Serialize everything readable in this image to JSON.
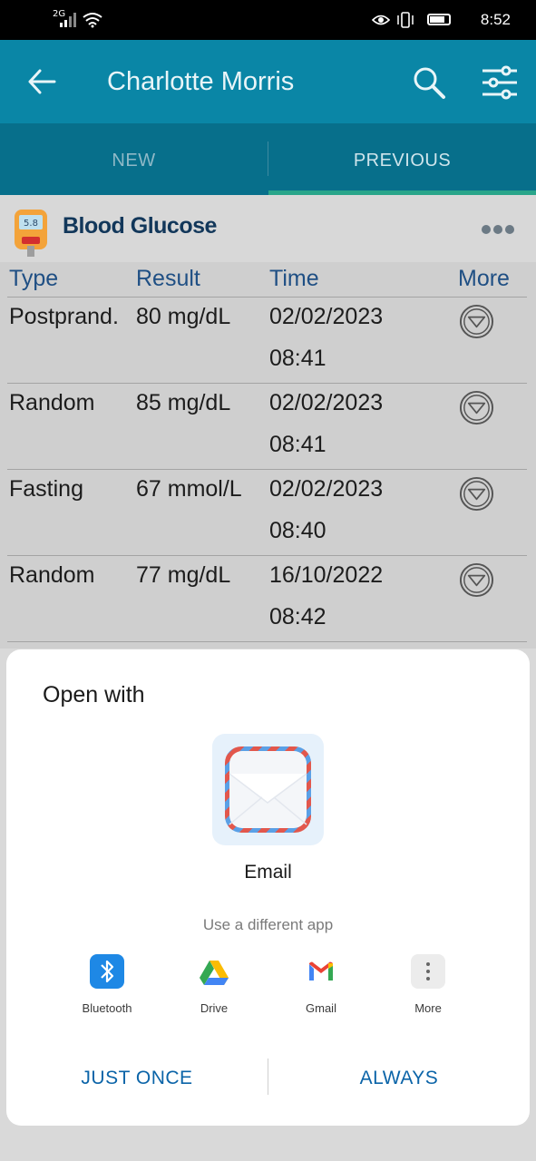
{
  "status_bar": {
    "network": "2G",
    "time": "8:52"
  },
  "app_bar": {
    "title": "Charlotte Morris"
  },
  "tabs": [
    {
      "label": "NEW"
    },
    {
      "label": "PREVIOUS"
    }
  ],
  "card": {
    "title": "Blood Glucose",
    "meter_reading": "5.8",
    "columns": [
      "Type",
      "Result",
      "Time",
      "More"
    ],
    "rows": [
      {
        "type": "Postprand.",
        "result": "80 mg/dL",
        "date": "02/02/2023",
        "time": "08:41"
      },
      {
        "type": "Random",
        "result": "85 mg/dL",
        "date": "02/02/2023",
        "time": "08:41"
      },
      {
        "type": "Fasting",
        "result": "67 mmol/L",
        "date": "02/02/2023",
        "time": "08:40"
      },
      {
        "type": "Random",
        "result": "77 mg/dL",
        "date": "16/10/2022",
        "time": "08:42"
      }
    ]
  },
  "sheet": {
    "title": "Open with",
    "primary_app": "Email",
    "different_app": "Use a different app",
    "apps": [
      {
        "label": "Bluetooth",
        "icon": "bluetooth-icon"
      },
      {
        "label": "Drive",
        "icon": "drive-icon"
      },
      {
        "label": "Gmail",
        "icon": "gmail-icon"
      },
      {
        "label": "More",
        "icon": "more-vertical-icon"
      }
    ],
    "just_once": "JUST ONCE",
    "always": "ALWAYS"
  },
  "colors": {
    "app_bar": "#0a86a6",
    "tabs": "#076f8b",
    "tab_indicator": "#29a58a",
    "accent_text": "#0b64a8"
  }
}
